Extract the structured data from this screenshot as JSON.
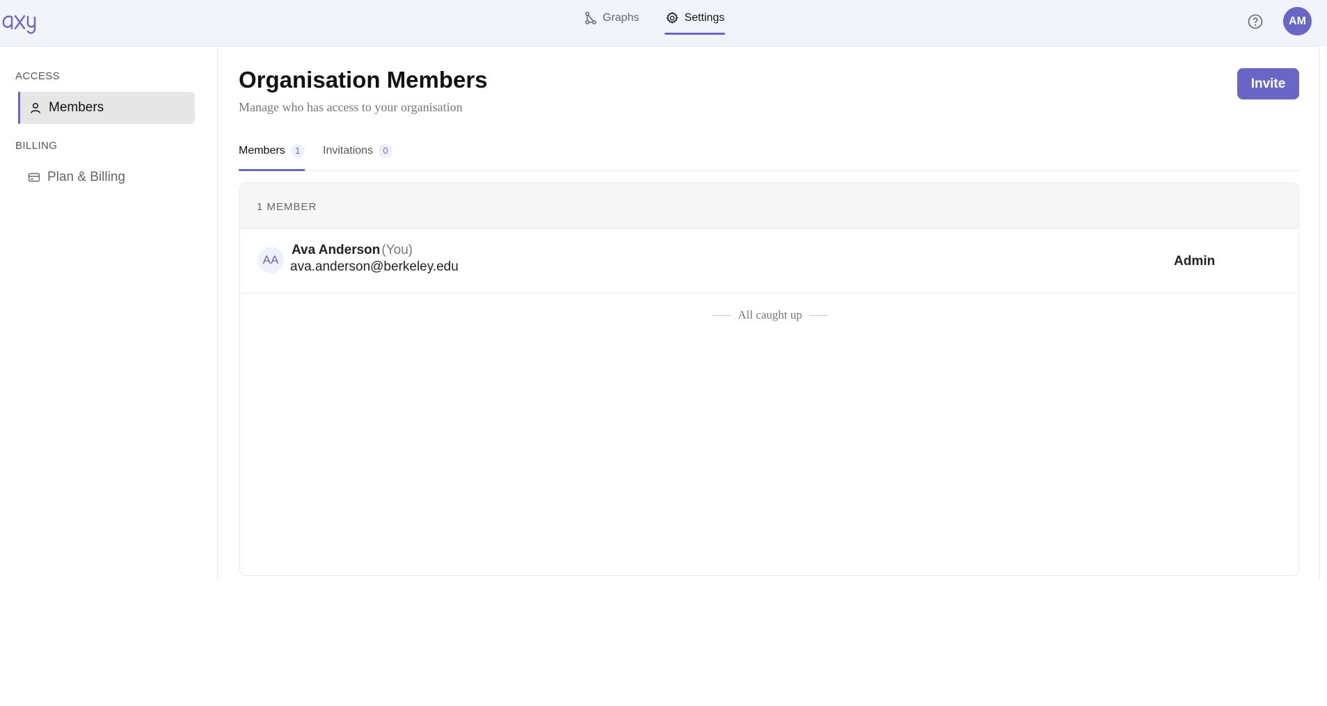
{
  "app": {
    "logo_text": "axy",
    "colors": {
      "accent": "#6a66c6",
      "topbar_bg": "#f1f4fb"
    }
  },
  "topnav": {
    "items": [
      {
        "label": "Graphs",
        "icon": "graph-icon",
        "active": false
      },
      {
        "label": "Settings",
        "icon": "gear-icon",
        "active": true
      }
    ],
    "help_icon": "help-circle-icon",
    "avatar_initials": "AM"
  },
  "sidebar": {
    "sections": [
      {
        "label": "ACCESS",
        "items": [
          {
            "label": "Members",
            "icon": "user-icon",
            "active": true
          }
        ]
      },
      {
        "label": "BILLING",
        "items": [
          {
            "label": "Plan & Billing",
            "icon": "card-icon",
            "active": false
          }
        ]
      }
    ]
  },
  "main": {
    "title": "Organisation Members",
    "subtitle": "Manage who has access to your organisation",
    "invite_label": "Invite",
    "tabs": [
      {
        "label": "Members",
        "count": "1",
        "active": true
      },
      {
        "label": "Invitations",
        "count": "0",
        "active": false
      }
    ],
    "panel": {
      "header": "1 MEMBER",
      "members": [
        {
          "initials": "AA",
          "name": "Ava Anderson",
          "you": "(You)",
          "email": "ava.anderson@berkeley.edu",
          "role": "Admin"
        }
      ],
      "footer": "All caught up"
    }
  }
}
